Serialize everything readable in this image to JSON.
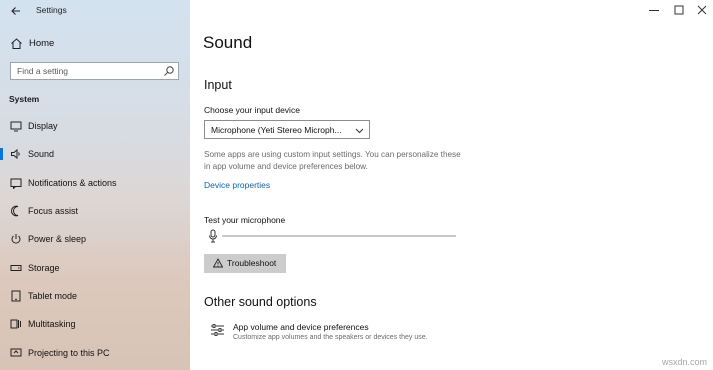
{
  "window": {
    "title": "Settings",
    "controls": [
      "minimize-icon",
      "maximize-icon",
      "close-icon"
    ]
  },
  "sidebar": {
    "home_label": "Home",
    "search_placeholder": "Find a setting",
    "section_label": "System",
    "items": [
      {
        "label": "Display",
        "icon": "display-icon",
        "active": false
      },
      {
        "label": "Sound",
        "icon": "speaker-icon",
        "active": true
      },
      {
        "label": "Notifications & actions",
        "icon": "notifications-icon",
        "active": false
      },
      {
        "label": "Focus assist",
        "icon": "moon-icon",
        "active": false
      },
      {
        "label": "Power & sleep",
        "icon": "power-icon",
        "active": false
      },
      {
        "label": "Storage",
        "icon": "storage-icon",
        "active": false
      },
      {
        "label": "Tablet mode",
        "icon": "tablet-icon",
        "active": false
      },
      {
        "label": "Multitasking",
        "icon": "multitasking-icon",
        "active": false
      },
      {
        "label": "Projecting to this PC",
        "icon": "projecting-icon",
        "active": false
      }
    ]
  },
  "main": {
    "page_title": "Sound",
    "input": {
      "heading": "Input",
      "device_label": "Choose your input device",
      "device_value": "Microphone (Yeti Stereo Microph...",
      "description": "Some apps are using custom input settings. You can personalize these in app volume and device preferences below.",
      "device_properties_link": "Device properties",
      "test_label": "Test your microphone",
      "mic_level": 0.0,
      "troubleshoot_label": "Troubleshoot"
    },
    "other": {
      "heading": "Other sound options",
      "app_volume_title": "App volume and device preferences",
      "app_volume_subtitle": "Customize app volumes and the speakers or devices they use."
    }
  },
  "watermark": "wsxdn.com",
  "colors": {
    "accent": "#0078d7",
    "link": "#0067b8",
    "button_bg": "#cccccc"
  }
}
